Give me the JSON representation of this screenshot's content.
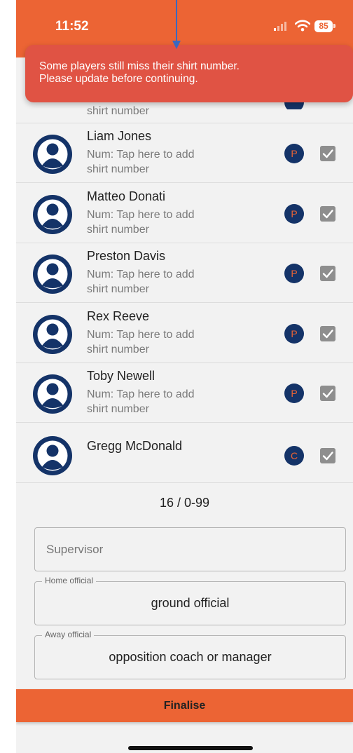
{
  "status_bar": {
    "time": "11:52",
    "battery": "85"
  },
  "toast": {
    "message_line1": "Some players still miss their shirt number.",
    "message_line2": "Please update before continuing."
  },
  "partial_row": {
    "number_tail": "shirt number"
  },
  "players": [
    {
      "name": "Liam Jones",
      "number_line1": "Num: Tap here to add",
      "number_line2": "shirt number",
      "role": "P",
      "checked": true
    },
    {
      "name": "Matteo Donati",
      "number_line1": "Num: Tap here to add",
      "number_line2": "shirt number",
      "role": "P",
      "checked": true
    },
    {
      "name": "Preston Davis",
      "number_line1": "Num: Tap here to add",
      "number_line2": "shirt number",
      "role": "P",
      "checked": true
    },
    {
      "name": "Rex Reeve",
      "number_line1": "Num: Tap here to add",
      "number_line2": "shirt number",
      "role": "P",
      "checked": true
    },
    {
      "name": "Toby Newell",
      "number_line1": "Num: Tap here to add",
      "number_line2": "shirt number",
      "role": "P",
      "checked": true
    },
    {
      "name": "Gregg McDonald",
      "number_line1": "",
      "number_line2": "",
      "role": "C",
      "checked": true
    }
  ],
  "count": "16 / 0-99",
  "supervisor": {
    "placeholder": "Supervisor",
    "value": ""
  },
  "home_official": {
    "legend": "Home official",
    "value": "ground official"
  },
  "away_official": {
    "legend": "Away official",
    "value": "opposition coach or manager"
  },
  "finalise_label": "Finalise",
  "colors": {
    "accent": "#ec6434",
    "navy": "#143368",
    "toast": "#e05344",
    "check": "#8e8e8e"
  },
  "icons": {
    "avatar": "user-avatar-icon",
    "check": "checkbox-checked-icon",
    "arrow": "annotation-arrow-icon"
  }
}
